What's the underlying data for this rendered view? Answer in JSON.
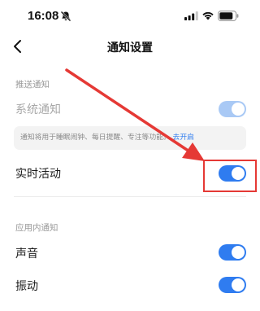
{
  "status_bar": {
    "time": "16:08",
    "icons": [
      "mute-icon",
      "signal-icon",
      "wifi-icon",
      "battery-icon"
    ]
  },
  "nav": {
    "title": "通知设置",
    "back_icon": "chevron-left-icon"
  },
  "sections": {
    "push": {
      "header": "推送通知",
      "system_notification": {
        "label": "系统通知",
        "toggle_on": true,
        "disabled": true
      },
      "info": {
        "text": "通知将用于睡眠闹钟、每日提醒、专注等功能。",
        "link": "去开启"
      },
      "live_activity": {
        "label": "实时活动",
        "toggle_on": true
      }
    },
    "in_app": {
      "header": "应用内通知",
      "sound": {
        "label": "声音",
        "toggle_on": true
      },
      "vibration": {
        "label": "振动",
        "toggle_on": true
      }
    }
  },
  "colors": {
    "accent": "#2f7cf0",
    "accent_disabled": "#a9c9f5",
    "annotation": "#e53935"
  }
}
